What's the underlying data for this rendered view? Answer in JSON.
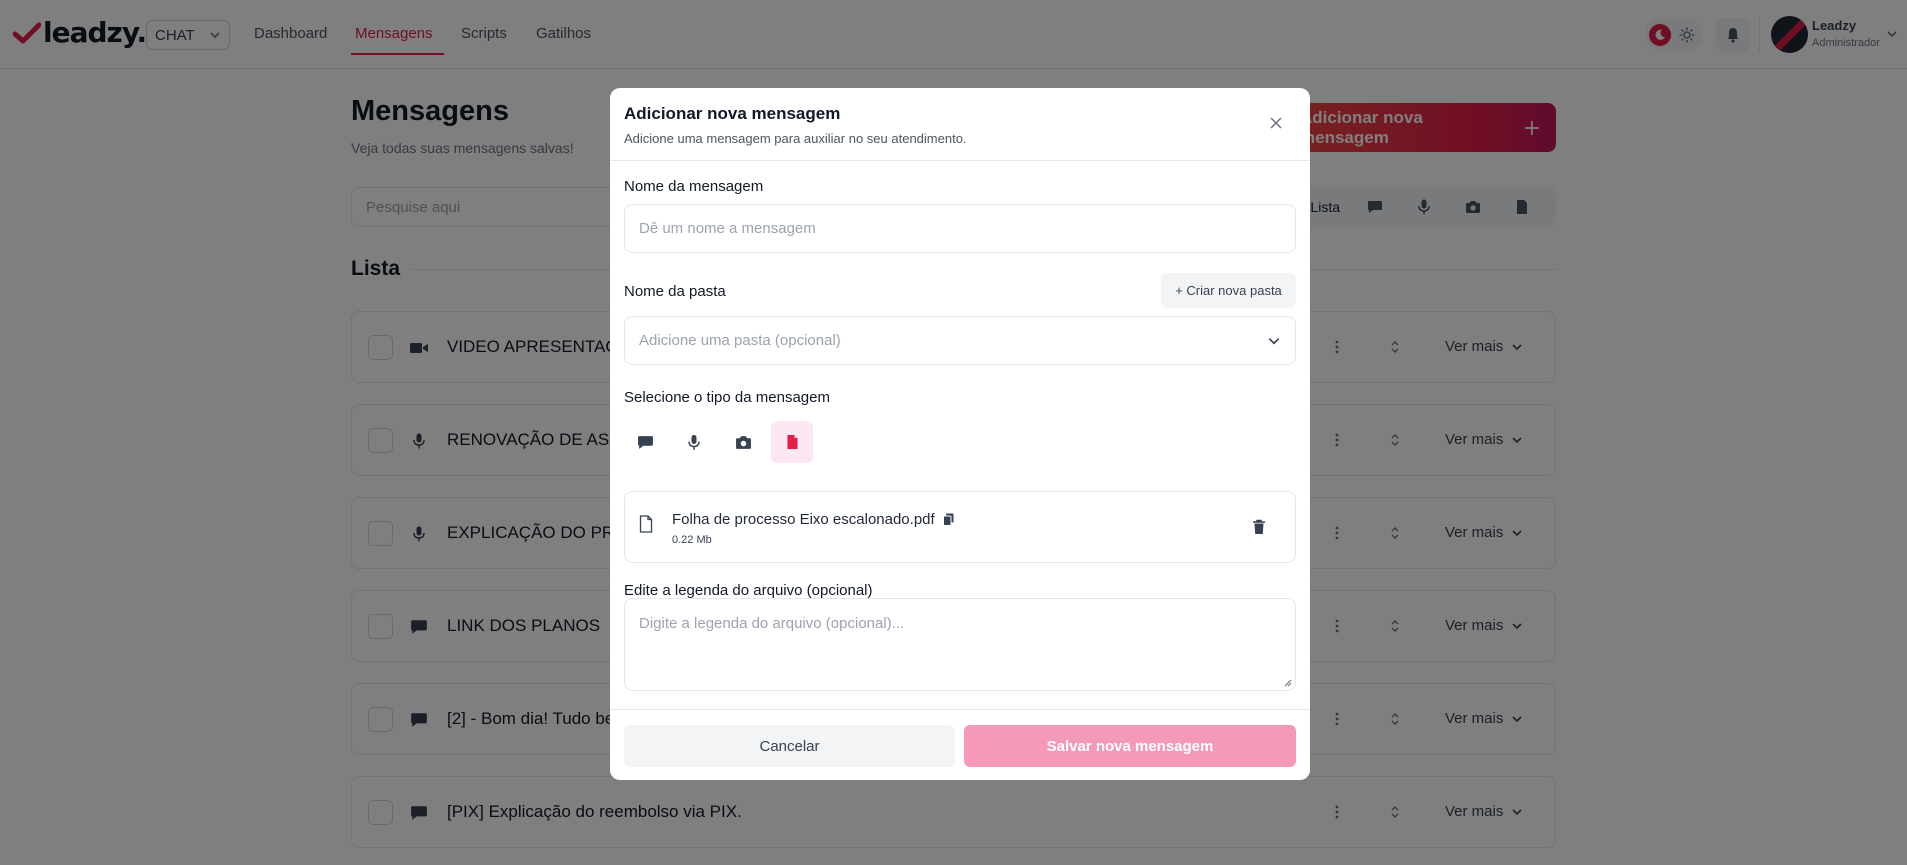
{
  "brand": {
    "logo_text": "leadzy.",
    "accent_color": "#e11d48"
  },
  "nav": {
    "selector_value": "CHAT",
    "links": [
      "Dashboard",
      "Mensagens",
      "Scripts",
      "Gatilhos"
    ],
    "active_link": "Mensagens"
  },
  "user": {
    "name": "Leadzy",
    "role": "Administrador"
  },
  "page": {
    "title": "Mensagens",
    "subtitle": "Veja todas suas mensagens salvas!",
    "add_button": "Adicionar nova mensagem",
    "search_placeholder": "Pesquise aqui",
    "view_list_label": "Lista",
    "section_title": "Lista",
    "rows": [
      {
        "title": "VIDEO APRESENTAÇÃ",
        "icon": "video-icon"
      },
      {
        "title": "RENOVAÇÃO DE ASSI",
        "icon": "microphone-icon"
      },
      {
        "title": "EXPLICAÇÃO DO PRO",
        "icon": "microphone-icon"
      },
      {
        "title": "LINK DOS PLANOS",
        "icon": "chat-bubble-icon"
      },
      {
        "title": "[2] - Bom dia! Tudo be",
        "icon": "chat-bubble-icon"
      },
      {
        "title": "[PIX] Explicação do reembolso via PIX.",
        "icon": "chat-bubble-icon"
      }
    ],
    "row_more_label": "Ver mais"
  },
  "modal": {
    "title": "Adicionar nova mensagem",
    "subtitle": "Adicione uma mensagem para auxiliar no seu atendimento.",
    "name_label": "Nome da mensagem",
    "name_placeholder": "Dê um nome a mensagem",
    "folder_label": "Nome da pasta",
    "create_folder_button": "+ Criar nova pasta",
    "folder_placeholder": "Adicione uma pasta (opcional)",
    "type_label": "Selecione o tipo da mensagem",
    "types": [
      "chat-bubble-icon",
      "microphone-icon",
      "camera-icon",
      "document-icon"
    ],
    "selected_type": "document-icon",
    "file": {
      "name": "Folha de processo Eixo escalonado.pdf",
      "size": "0.22 Mb"
    },
    "caption_label": "Edite a legenda do arquivo (opcional)",
    "caption_placeholder": "Digite a legenda do arquivo (opcional)...",
    "cancel_button": "Cancelar",
    "save_button": "Salvar nova mensagem"
  }
}
